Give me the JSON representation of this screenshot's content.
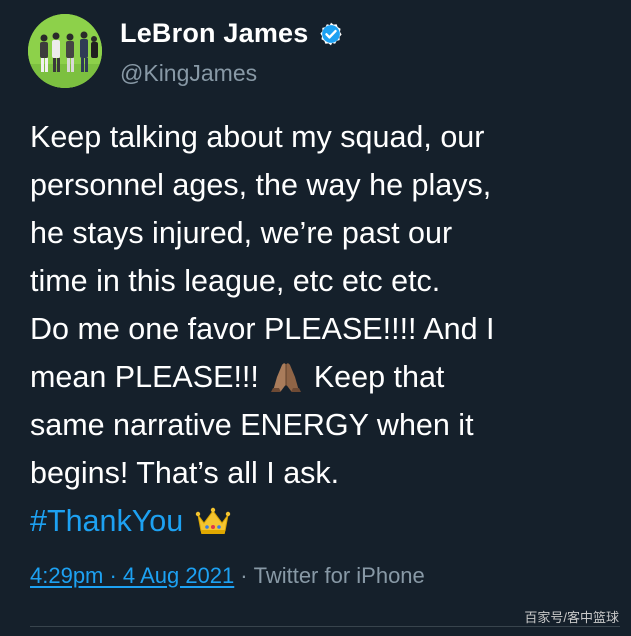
{
  "author": {
    "display_name": "LeBron James",
    "handle": "@KingJames",
    "verified": true,
    "avatar_icon": "avatar-photo"
  },
  "tweet": {
    "text_before_emoji": "Keep talking about my squad, our\npersonnel ages, the way he plays,\nhe stays injured, we’re past our\ntime in this league, etc etc etc.\nDo me one favor PLEASE!!!! And I\nmean PLEASE!!! ",
    "emoji_1": "folded-hands-icon",
    "text_after_emoji": " Keep that\nsame narrative ENERGY when it\nbegins! That’s all I ask.",
    "hashtag": "#ThankYou",
    "emoji_2": "crown-icon"
  },
  "meta": {
    "timestamp": "4:29pm · 4 Aug 2021",
    "separator": "·",
    "source": "Twitter for iPhone"
  },
  "watermark": "百家号/客中篮球",
  "colors": {
    "background": "#15202b",
    "link": "#1da1f2",
    "secondary_text": "#8899a6",
    "verified_badge": "#1da1f2"
  }
}
